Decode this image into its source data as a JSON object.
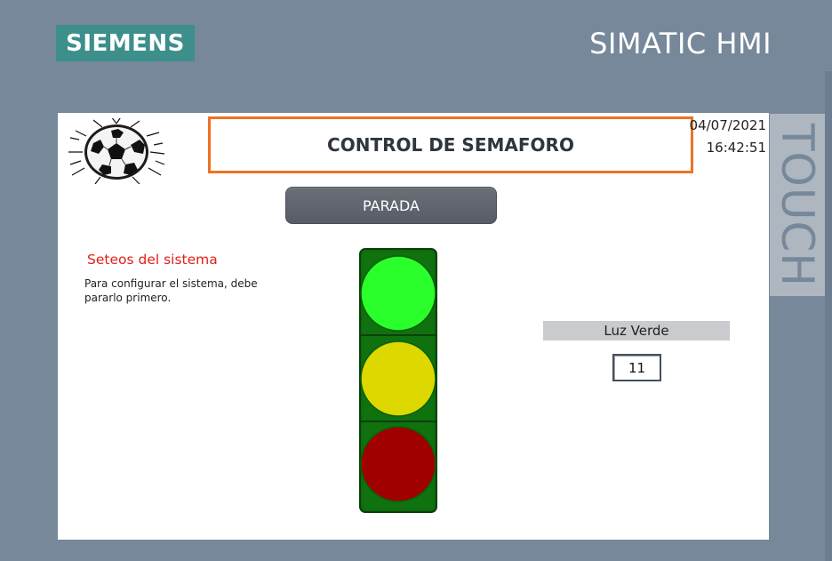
{
  "frame": {
    "brand_logo": "SIEMENS",
    "brand_title": "SIMATIC HMI",
    "side_label": "TOUCH"
  },
  "screen": {
    "logo_icon": "soccer-ball-icon",
    "title": "CONTROL DE SEMAFORO",
    "date": "04/07/2021",
    "time": "16:42:51",
    "stop_button_label": "PARADA",
    "settings": {
      "title": "Seteos del sistema",
      "description": "Para configurar el sistema, debe pararlo primero."
    },
    "traffic_light": {
      "green_color": "#2bff2b",
      "yellow_color": "#dcd800",
      "red_color": "#a00000",
      "housing_color": "#0d6b0d"
    },
    "luz": {
      "label": "Luz Verde",
      "value": "11"
    }
  },
  "colors": {
    "frame": "#76889a",
    "logo_bg": "#3d8f8c",
    "title_border": "#ee7222",
    "accent_text": "#e0201a"
  }
}
